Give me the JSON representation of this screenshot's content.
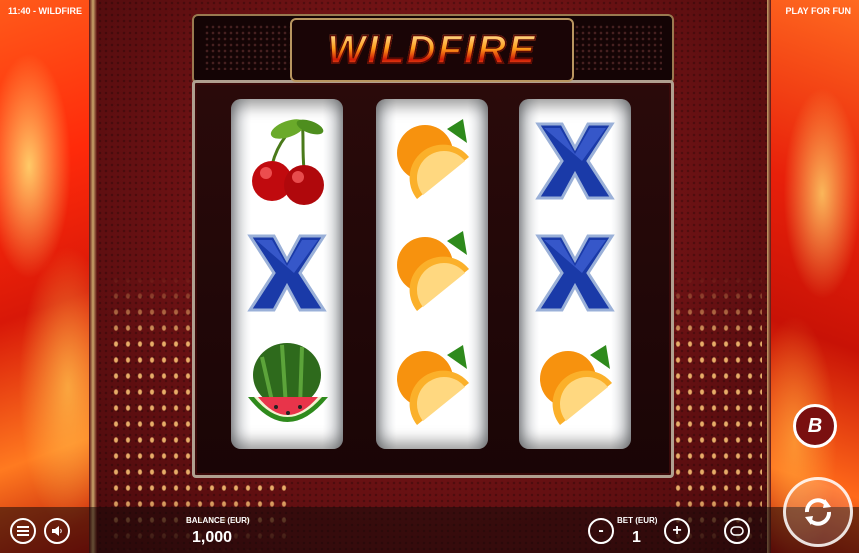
{
  "header": {
    "time_title": "11:40 - WILDFIRE",
    "mode": "PLAY FOR FUN"
  },
  "logo": {
    "text": "WILDFIRE"
  },
  "reels": [
    {
      "symbols": [
        "cherry",
        "x",
        "watermelon"
      ]
    },
    {
      "symbols": [
        "orange",
        "orange",
        "orange"
      ]
    },
    {
      "symbols": [
        "x",
        "x",
        "orange"
      ]
    }
  ],
  "footer": {
    "balance_label": "BALANCE (EUR)",
    "balance_value": "1,000",
    "bet_label": "BET (EUR)",
    "bet_value": "1",
    "minus": "-",
    "plus": "+"
  },
  "icons": {
    "menu": "menu-icon",
    "sound": "sound-icon",
    "autoplay": "autoplay-icon",
    "spin": "spin-icon",
    "boost": "boost-b-icon"
  },
  "colors": {
    "accent": "#ffb23a",
    "frame": "#b99660",
    "background": "#6e1214"
  }
}
